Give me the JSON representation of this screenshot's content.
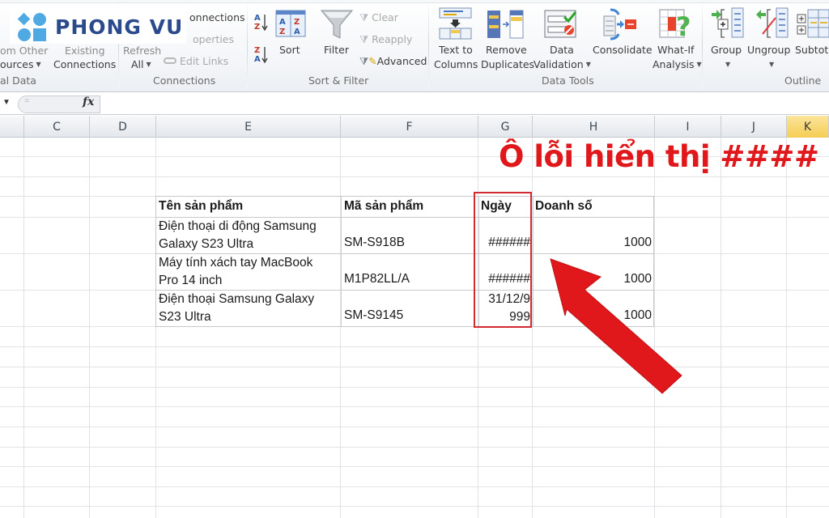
{
  "logo": {
    "text": "PHONG VU"
  },
  "ribbon": {
    "get_external_data": {
      "from_other_sources": "ources",
      "group_label": "al Data"
    },
    "existing_connections": {
      "line1": "Existing",
      "line2": "Connections"
    },
    "connections_group": {
      "refresh_all_line1": "Refresh",
      "refresh_all_line2": "All",
      "connections": "onnections",
      "properties": "operties",
      "edit_links": "Edit Links",
      "group_label": "Connections"
    },
    "sort_filter": {
      "sort_az_icon": "A→Z",
      "sort_za_icon": "Z→A",
      "sort": "Sort",
      "filter": "Filter",
      "clear": "Clear",
      "reapply": "Reapply",
      "advanced": "Advanced",
      "group_label": "Sort & Filter"
    },
    "data_tools": {
      "text_to_columns_1": "Text to",
      "text_to_columns_2": "Columns",
      "remove_duplicates_1": "Remove",
      "remove_duplicates_2": "Duplicates",
      "data_validation_1": "Data",
      "data_validation_2": "Validation",
      "consolidate": "Consolidate",
      "what_if_1": "What-If",
      "what_if_2": "Analysis",
      "group_label": "Data Tools"
    },
    "outline": {
      "group": "Group",
      "ungroup": "Ungroup",
      "subtotal": "Subtota",
      "group_label": "Outline"
    }
  },
  "formula_bar": {
    "eq": "=",
    "fx": "fx",
    "value": ""
  },
  "columns": [
    "C",
    "D",
    "E",
    "F",
    "G",
    "H",
    "I",
    "J",
    "K"
  ],
  "selected_column": "K",
  "table": {
    "headers": [
      "Tên sản phẩm",
      "Mã sản phẩm",
      "Ngày",
      "Doanh số"
    ],
    "rows": [
      {
        "name_l1": "Điện thoại di động Samsung",
        "name_l2": "Galaxy S23 Ultra",
        "code": "SM-S918B",
        "date_l1": "",
        "date_l2": "######",
        "sales": "1000"
      },
      {
        "name_l1": "Máy tính xách tay MacBook",
        "name_l2": "Pro 14 inch",
        "code": "M1P82LL/A",
        "date_l1": "",
        "date_l2": "######",
        "sales": "1000"
      },
      {
        "name_l1": "Điện thoại Samsung Galaxy",
        "name_l2": "S23 Ultra",
        "code": "SM-S9145",
        "date_l1": "31/12/9",
        "date_l2": "999",
        "sales": "1000"
      }
    ]
  },
  "annotation": {
    "text": "Ô lỗi hiển thị ####",
    "color": "#e0181b"
  }
}
